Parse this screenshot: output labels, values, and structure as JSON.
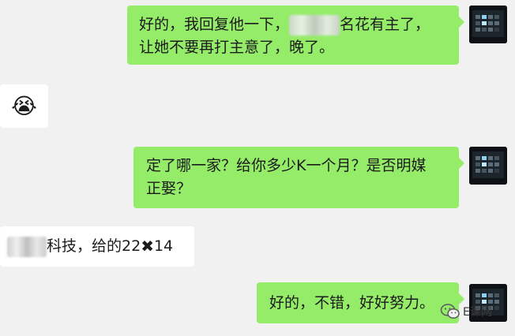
{
  "messages": [
    {
      "side": "out",
      "line1_before": "好的，我回复他一下，",
      "line1_after": "名花有主了，",
      "line2": "让她不要再打主意了，晚了。"
    },
    {
      "side": "in",
      "emoji": "😭"
    },
    {
      "side": "out",
      "line1": "定了哪一家？给你多少K一个月？是否明媒",
      "line2": "正娶？"
    },
    {
      "side": "in",
      "text_before": "科技，给的22",
      "text_mark": "✖",
      "text_after": "14"
    },
    {
      "side": "out",
      "text": "好的，不错，好好努力。"
    }
  ],
  "watermark": {
    "text": "E课网",
    "icon": "wechat-icon"
  },
  "colors": {
    "background": "#f1f1f1",
    "outgoing_bubble": "#95ec69",
    "incoming_bubble": "#ffffff"
  }
}
